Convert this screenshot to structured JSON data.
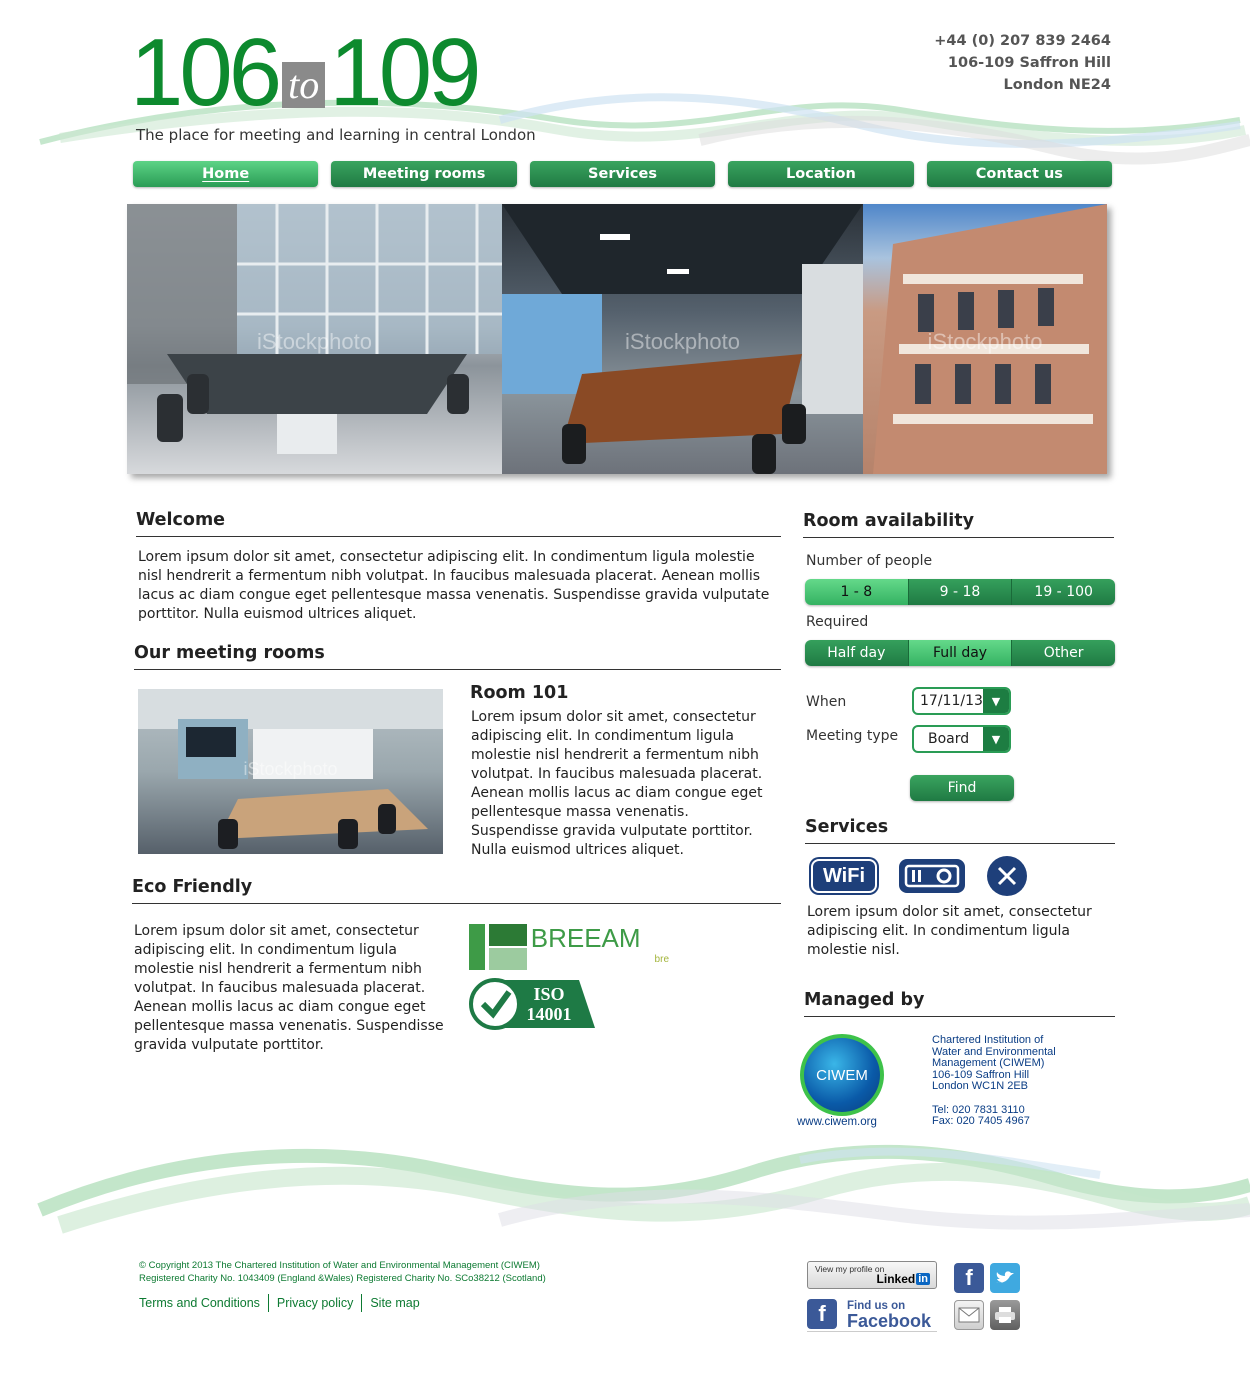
{
  "header": {
    "logo_left": "106",
    "logo_mid": "to",
    "logo_right": "109",
    "tagline": "The place for meeting and learning in central London",
    "address": [
      "+44 (0) 207 839 2464",
      "106-109 Saffron Hill",
      "London NE24"
    ]
  },
  "nav": {
    "items": [
      {
        "label": "Home",
        "active": true
      },
      {
        "label": "Meeting rooms",
        "active": false
      },
      {
        "label": "Services",
        "active": false
      },
      {
        "label": "Location",
        "active": false
      },
      {
        "label": "Contact us",
        "active": false
      }
    ]
  },
  "banner": {
    "watermark": "iStockphoto"
  },
  "welcome": {
    "title": "Welcome",
    "text": "Lorem ipsum dolor sit amet, consectetur adipiscing elit. In condimentum ligula molestie nisl hendrerit a fermentum nibh volutpat. In faucibus malesuada placerat. Aenean mollis lacus ac diam congue eget pellentesque massa venenatis. Suspendisse gravida vulputate porttitor. Nulla euismod ultrices aliquet."
  },
  "rooms": {
    "title": "Our meeting rooms",
    "room_title": "Room 101",
    "room_text": "Lorem ipsum dolor sit amet, consectetur adipiscing elit. In condimentum ligula molestie nisl hendrerit a fermentum nibh volutpat. In faucibus malesuada placerat. Aenean mollis lacus ac diam congue eget pellentesque massa venenatis. Suspendisse gravida vulputate porttitor. Nulla euismod ultrices aliquet."
  },
  "eco": {
    "title": "Eco Friendly",
    "text": "Lorem ipsum dolor sit amet, consectetur adipiscing elit. In condimentum ligula molestie nisl hendrerit a fermentum nibh volutpat. In faucibus malesuada placerat. Aenean mollis lacus ac diam congue eget pellentesque massa venenatis. Suspendisse gravida vulputate porttitor.",
    "breeam": "BREEAM",
    "bre": "bre",
    "iso": "ISO 14001"
  },
  "availability": {
    "title": "Room availability",
    "people_label": "Number of people",
    "people_options": [
      "1 - 8",
      "9 - 18",
      "19 - 100"
    ],
    "people_selected": 0,
    "required_label": "Required",
    "required_options": [
      "Half day",
      "Full day",
      "Other"
    ],
    "required_selected": 1,
    "when_label": "When",
    "when_value": "17/11/13",
    "type_label": "Meeting type",
    "type_value": "Board",
    "find_label": "Find"
  },
  "services": {
    "title": "Services",
    "icons": [
      "wifi-icon",
      "projector-icon",
      "catering-icon"
    ],
    "wifi_text": "WiFi",
    "text": "Lorem ipsum dolor sit amet, consectetur adipiscing elit. In condimentum ligula molestie nisl."
  },
  "managed": {
    "title": "Managed by",
    "logo_text": "CIWEM",
    "url": "www.ciwem.org",
    "address": [
      "Chartered Institution of",
      "Water and Environmental",
      "Management (CIWEM)",
      "106-109 Saffron Hill",
      "London WC1N 2EB",
      "",
      "Tel: 020 7831 3110",
      "Fax: 020 7405 4967"
    ]
  },
  "footer": {
    "copyright": "© Copyright 2013 The Chartered Institution of Water and Environmental Management (CIWEM)",
    "charity": "Registered Charity No. 1043409 (England &Wales)   Registered Charity No. SCo38212 (Scotland)",
    "links": [
      "Terms and Conditions",
      "Privacy policy",
      "Site map"
    ],
    "linkedin_top": "View my profile on",
    "linkedin_brand": "Linked",
    "linkedin_in": "in",
    "facebook_top": "Find us on",
    "facebook_brand": "Facebook"
  },
  "colors": {
    "brand_green": "#0d8a2e",
    "nav_green": "#1f7a43",
    "link_green": "#0d7a32",
    "ciwem_blue": "#0a3d85"
  }
}
